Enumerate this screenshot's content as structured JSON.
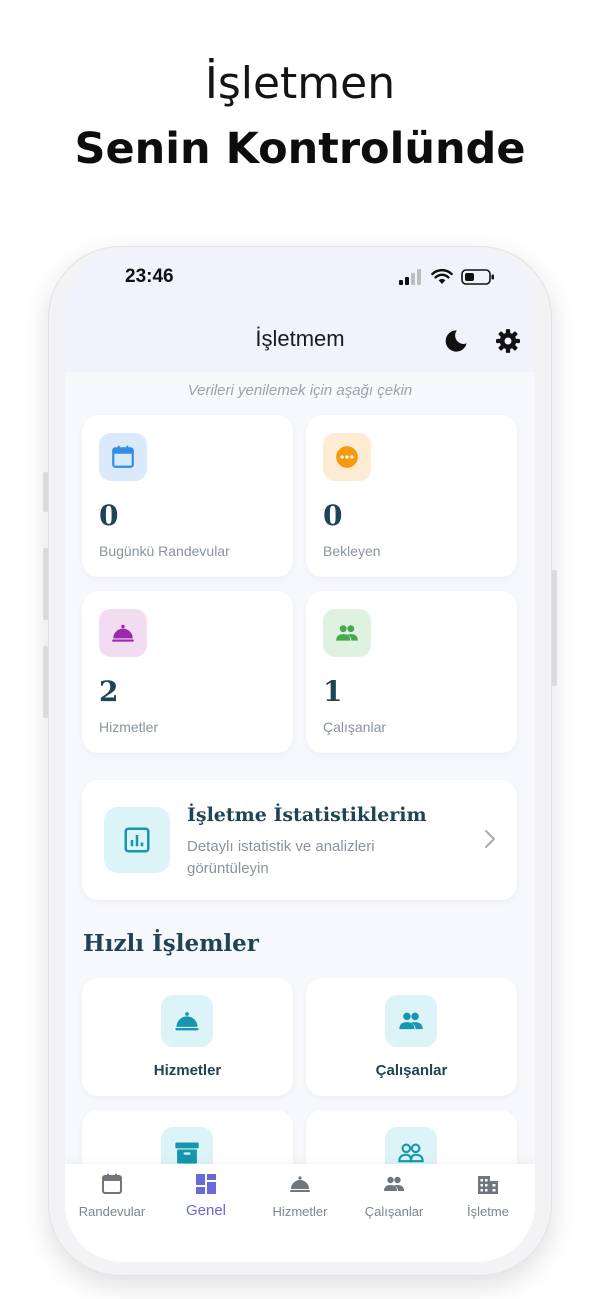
{
  "promo": {
    "line1": "İşletmen",
    "line2": "Senin Kontrolünde"
  },
  "status_bar": {
    "time": "23:46"
  },
  "header": {
    "title": "İşletmem"
  },
  "hint": "Verileri yenilemek için aşağı çekin",
  "stats": [
    {
      "value": "0",
      "label": "Bugünkü Randevular",
      "icon": "calendar-icon",
      "color": "#2f8ee8",
      "bg": "#dbeafb"
    },
    {
      "value": "0",
      "label": "Bekleyen",
      "icon": "more-horiz-icon",
      "color": "#f59a10",
      "bg": "#fdebd3"
    },
    {
      "value": "2",
      "label": "Hizmetler",
      "icon": "cloche-icon",
      "color": "#9b2aa9",
      "bg": "#f1dcf1"
    },
    {
      "value": "1",
      "label": "Çalışanlar",
      "icon": "people-icon",
      "color": "#48a84f",
      "bg": "#dff1e0"
    }
  ],
  "business_stats": {
    "title": "İşletme İstatistiklerim",
    "subtitle": "Detaylı istatistik ve analizleri görüntüleyin",
    "icon": "analytics-icon",
    "color": "#1597ad"
  },
  "quick_actions": {
    "title": "Hızlı İşlemler",
    "items": [
      {
        "label": "Hizmetler",
        "icon": "cloche-icon"
      },
      {
        "label": "Çalışanlar",
        "icon": "people-icon"
      },
      {
        "label": "",
        "icon": "archive-icon"
      },
      {
        "label": "",
        "icon": "people-outline-icon"
      }
    ],
    "icon_color": "#1597ad"
  },
  "tabs": [
    {
      "label": "Randevular",
      "icon": "calendar-icon",
      "active": false
    },
    {
      "label": "Genel",
      "icon": "dashboard-icon",
      "active": true
    },
    {
      "label": "Hizmetler",
      "icon": "cloche-icon",
      "active": false
    },
    {
      "label": "Çalışanlar",
      "icon": "people-icon",
      "active": false
    },
    {
      "label": "İşletme",
      "icon": "building-icon",
      "active": false
    }
  ],
  "colors": {
    "accent": "#6a69d9",
    "heading": "#1e4456",
    "muted": "#8a939c",
    "tab_inactive": "#7d858d"
  }
}
